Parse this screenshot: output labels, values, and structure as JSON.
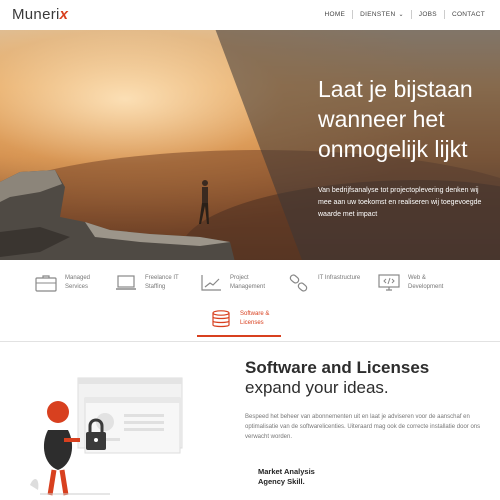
{
  "header": {
    "logo_main": "Muneri",
    "logo_accent": "x",
    "nav": [
      {
        "label": "HOME"
      },
      {
        "label": "DIENSTEN"
      },
      {
        "label": "JOBS"
      },
      {
        "label": "CONTACT"
      }
    ]
  },
  "hero": {
    "title": "Laat je bijstaan wanneer het onmogelijk lijkt",
    "text": "Van bedrijfsanalyse tot projectoplevering denken wij mee aan uw toekomst en realiseren wij toegevoegde waarde met impact"
  },
  "tabs": [
    {
      "label": "Managed Services",
      "icon": "briefcase-icon"
    },
    {
      "label": "Freelance IT Staffing",
      "icon": "laptop-icon"
    },
    {
      "label": "Project Management",
      "icon": "chart-icon"
    },
    {
      "label": "IT Infrastructure",
      "icon": "link-icon"
    },
    {
      "label": "Web & Development",
      "icon": "code-monitor-icon"
    },
    {
      "label": "Software & Licenses",
      "icon": "database-icon",
      "active": true
    }
  ],
  "content": {
    "title": "Software and Licenses",
    "subtitle": "expand your ideas.",
    "body": "Bespeed het beheer van abonnementen uit en laat je adviseren voor de aanschaf en optimalisatie van de softwarelicenties. Uiteraard mag ook de correcte installatie door ons verwacht worden.",
    "sub2_line1": "Market Analysis",
    "sub2_line2": "Agency Skill."
  },
  "colors": {
    "accent": "#d8401f"
  }
}
